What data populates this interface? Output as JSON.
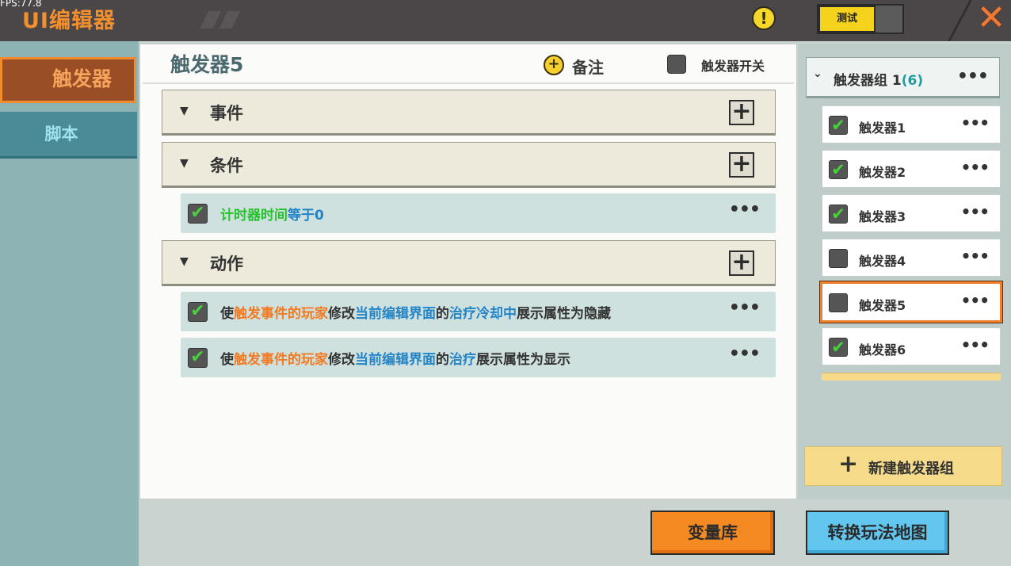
{
  "topbar": {
    "fps": "FPS:77.8",
    "title": "UI编辑器",
    "warn_icon": "!",
    "test_label": "测试",
    "close_icon": "✕"
  },
  "nav": {
    "items": [
      {
        "label": "触发器",
        "active": true
      },
      {
        "label": "脚本",
        "active": false
      }
    ]
  },
  "main": {
    "title": "触发器5",
    "note_label": "备注",
    "switch_label": "触发器开关",
    "sections": {
      "event": {
        "label": "事件"
      },
      "condition": {
        "label": "条件"
      },
      "action": {
        "label": "动作"
      }
    },
    "conditions": [
      {
        "checked": true,
        "parts": [
          "计时器时间",
          "等于0"
        ]
      }
    ],
    "actions": [
      {
        "checked": true,
        "parts": [
          "使",
          "触发事件的玩家",
          "修改",
          "当前编辑界面",
          "的",
          "治疗冷却中",
          "展示属性为隐藏"
        ]
      },
      {
        "checked": true,
        "parts": [
          "使",
          "触发事件的玩家",
          "修改",
          "当前编辑界面",
          "的",
          "治疗",
          "展示属性为显示"
        ]
      }
    ],
    "more_icon": "•••"
  },
  "right": {
    "group": {
      "name": "触发器组 1",
      "count": "(6)"
    },
    "triggers": [
      {
        "name": "触发器1",
        "checked": true,
        "selected": false
      },
      {
        "name": "触发器2",
        "checked": true,
        "selected": false
      },
      {
        "name": "触发器3",
        "checked": true,
        "selected": false
      },
      {
        "name": "触发器4",
        "checked": false,
        "selected": false
      },
      {
        "name": "触发器5",
        "checked": false,
        "selected": true
      },
      {
        "name": "触发器6",
        "checked": true,
        "selected": false
      }
    ],
    "new_group_label": "新建触发器组"
  },
  "bottom": {
    "variable_library": "变量库",
    "switch_map": "转换玩法地图"
  },
  "colors": {
    "accent_orange": "#f27a23",
    "link_blue": "#2384c7",
    "check_green": "#47d03a",
    "selected_border": "#f17e2a"
  }
}
